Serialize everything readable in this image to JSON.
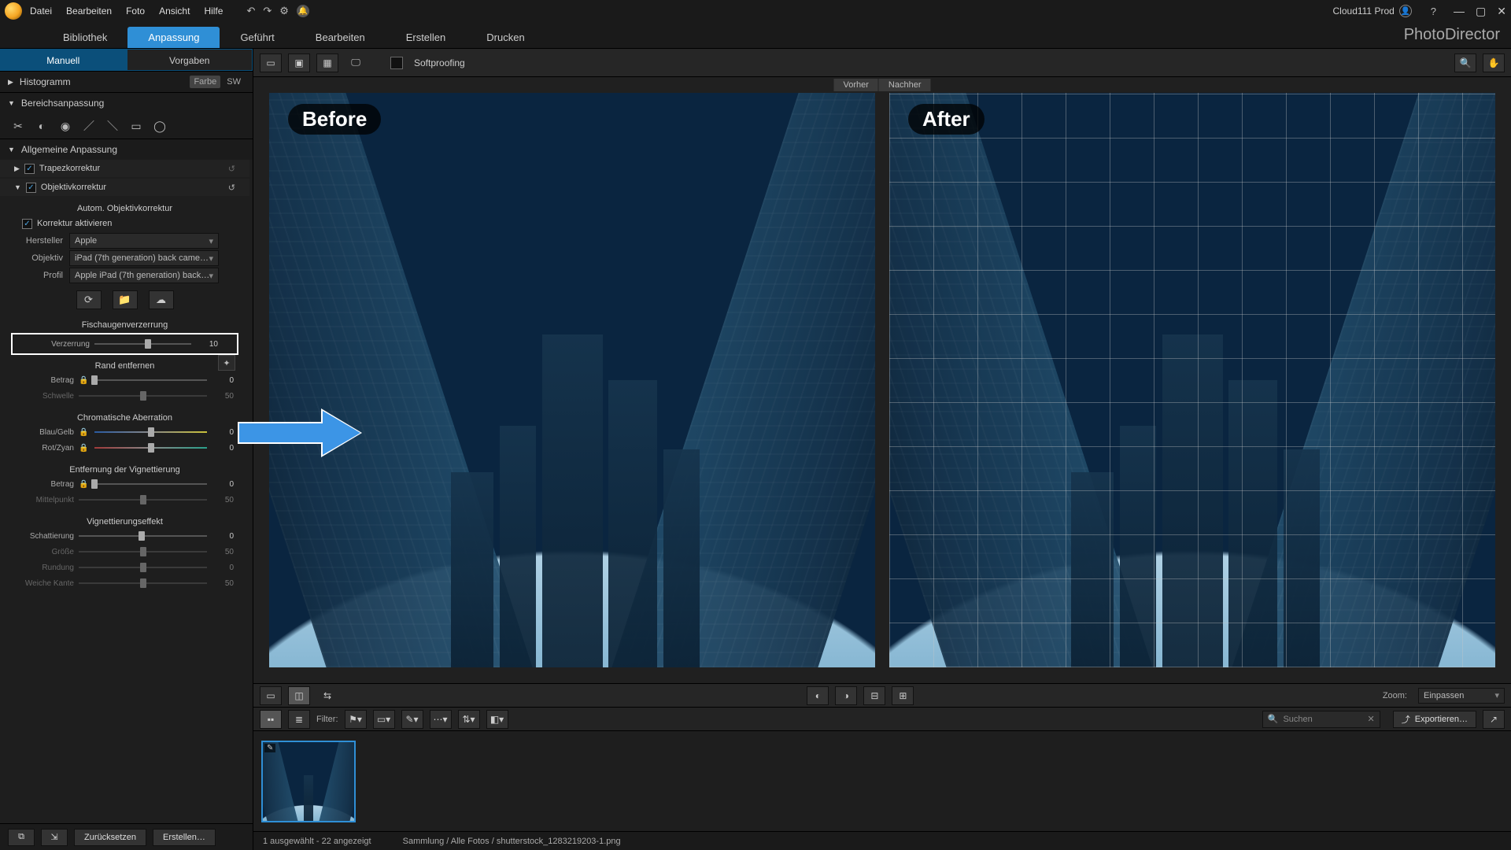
{
  "app": {
    "brand": "PhotoDirector"
  },
  "account": "Cloud111 Prod",
  "menu": [
    "Datei",
    "Bearbeiten",
    "Foto",
    "Ansicht",
    "Hilfe"
  ],
  "modules": [
    "Bibliothek",
    "Anpassung",
    "Geführt",
    "Bearbeiten",
    "Erstellen",
    "Drucken"
  ],
  "active_module": 1,
  "side_tabs": {
    "left": "Manuell",
    "right": "Vorgaben"
  },
  "histogram": {
    "title": "Histogramm",
    "modes": {
      "color": "Farbe",
      "bw": "SW"
    }
  },
  "region": {
    "title": "Bereichsanpassung"
  },
  "general": {
    "title": "Allgemeine Anpassung"
  },
  "keystone": {
    "title": "Trapezkorrektur"
  },
  "lens": {
    "title": "Objektivkorrektur",
    "auto": "Autom. Objektivkorrektur",
    "enable": "Korrektur aktivieren",
    "maker_label": "Hersteller",
    "maker_value": "Apple",
    "lens_label": "Objektiv",
    "lens_value": "iPad (7th generation) back came…",
    "profile_label": "Profil",
    "profile_value": "Apple iPad (7th generation) back…",
    "fisheye_title": "Fischaugenverzerrung",
    "distortion_label": "Verzerrung",
    "distortion_value": "10",
    "defringe_title": "Rand entfernen",
    "amount_label": "Betrag",
    "amount_value": "0",
    "threshold_label": "Schwelle",
    "threshold_value": "50",
    "ca_title": "Chromatische Aberration",
    "by_label": "Blau/Gelb",
    "by_value": "0",
    "rc_label": "Rot/Zyan",
    "rc_value": "0",
    "vig_rem_title": "Entfernung der Vignettierung",
    "vr_amount_label": "Betrag",
    "vr_amount_value": "0",
    "vr_mid_label": "Mittelpunkt",
    "vr_mid_value": "50",
    "vig_eff_title": "Vignettierungseffekt",
    "shade_label": "Schattierung",
    "shade_value": "0",
    "size_label": "Größe",
    "size_value": "50",
    "round_label": "Rundung",
    "round_value": "0",
    "feather_label": "Weiche Kante",
    "feather_value": "50"
  },
  "side_footer": {
    "reset": "Zurücksetzen",
    "create": "Erstellen…"
  },
  "view": {
    "softproof": "Softproofing",
    "before": "Vorher",
    "after": "Nachher",
    "before_badge": "Before",
    "after_badge": "After",
    "zoom_label": "Zoom:",
    "zoom_value": "Einpassen"
  },
  "filmstrip": {
    "filter_label": "Filter:",
    "search_placeholder": "Suchen",
    "export": "Exportieren…"
  },
  "status": {
    "selection": "1 ausgewählt - 22 angezeigt",
    "path": "Sammlung / Alle Fotos / shutterstock_1283219203-1.png"
  }
}
